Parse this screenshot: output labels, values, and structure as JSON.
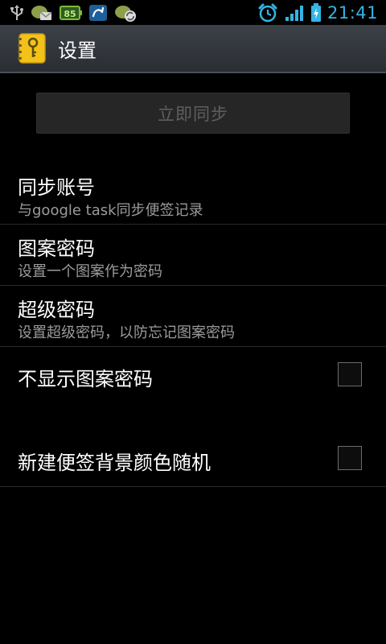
{
  "status_bar": {
    "time": "21:41",
    "battery_icon": "battery-charging-icon",
    "signal_icon": "signal-bars-icon",
    "alarm_icon": "alarm-clock-icon",
    "left_icons": [
      "usb-icon",
      "mail-notification-icon",
      "battery-85-icon",
      "app-notification-icon",
      "sync-notification-icon"
    ],
    "battery_badge": "85",
    "accent": "#33b5e5"
  },
  "action_bar": {
    "app_icon": "notebook-key-icon",
    "title": "设置"
  },
  "sync_button": {
    "label": "立即同步"
  },
  "settings": [
    {
      "title": "同步账号",
      "subtitle": "与google task同步便签记录"
    },
    {
      "title": "图案密码",
      "subtitle": "设置一个图案作为密码"
    },
    {
      "title": "超级密码",
      "subtitle": "设置超级密码，以防忘记图案密码"
    },
    {
      "title": "不显示图案密码",
      "checked": false
    },
    {
      "title": "新建便签背景颜色随机",
      "checked": false
    }
  ]
}
